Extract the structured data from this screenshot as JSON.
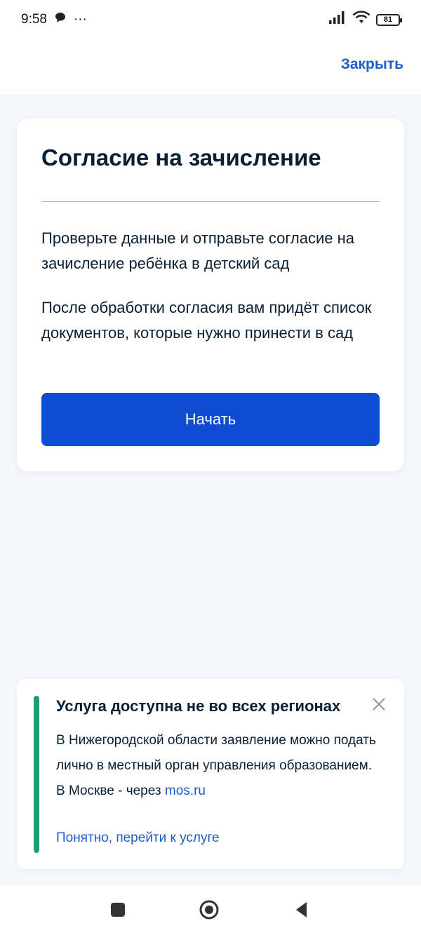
{
  "status_bar": {
    "time": "9:58",
    "more": "···",
    "battery": "81"
  },
  "top_bar": {
    "close_label": "Закрыть"
  },
  "card": {
    "title": "Согласие на зачисление",
    "paragraph1": "Проверьте данные и отправьте согласие на зачисление ребёнка в детский сад",
    "paragraph2": "После обработки согласия вам придёт список документов, которые нужно принести в сад",
    "start_label": "Начать"
  },
  "notice": {
    "title": "Услуга доступна не во всех регионах",
    "body_line1": "В Нижегородской области заявление можно подать лично в местный орган управления образованием.",
    "body_line2_prefix": "В Москве - через ",
    "body_link": "mos.ru",
    "action_label": "Понятно, перейти к услуге"
  },
  "colors": {
    "accent": "#0d4cd3",
    "link": "#1b5ec8",
    "success_bar": "#1d9e7b",
    "background": "#f5f7fc"
  },
  "icons": {
    "chat": "chat-bubble-icon",
    "signal": "signal-icon",
    "wifi": "wifi-icon",
    "battery": "battery-icon",
    "close": "close-icon",
    "nav_recent": "square-icon",
    "nav_home": "circle-icon",
    "nav_back": "back-triangle-icon"
  }
}
